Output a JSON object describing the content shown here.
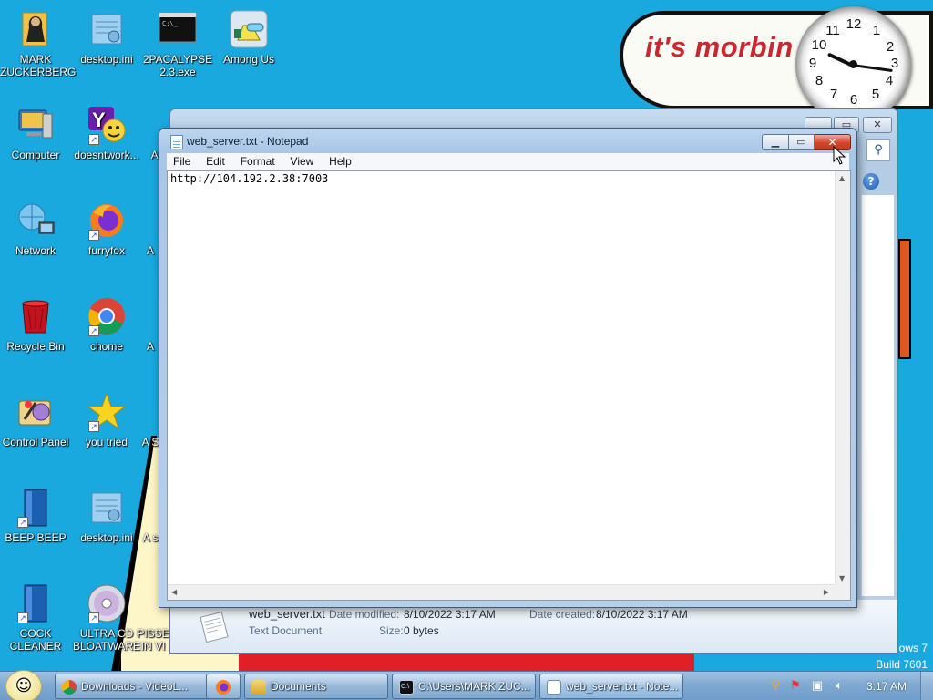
{
  "wallpaper": {
    "bubble_text": "it's morbin",
    "clock_numbers": [
      "12",
      "1",
      "2",
      "3",
      "4",
      "5",
      "6",
      "7",
      "8",
      "9",
      "10",
      "11"
    ],
    "windows_watermark": "lows 7",
    "build_text": "Build 7601"
  },
  "desktop_icons": [
    {
      "label": "MARK ZUCKERBERG",
      "icon": "user-folder-icon"
    },
    {
      "label": "desktop.ini",
      "icon": "settings-file-icon"
    },
    {
      "label": "2PACALYPSE 2.3.exe",
      "icon": "console-app-icon"
    },
    {
      "label": "Among Us",
      "icon": "among-us-icon"
    },
    {
      "label": "Computer",
      "icon": "computer-icon"
    },
    {
      "label": "doesntwork...",
      "icon": "yahoo-icon"
    },
    {
      "label": "Al",
      "icon": "partial-app-icon"
    },
    {
      "label": "Network",
      "icon": "network-icon"
    },
    {
      "label": "furryfox",
      "icon": "firefox-icon"
    },
    {
      "label": "A",
      "icon": "partial-app-icon"
    },
    {
      "label": "Recycle Bin",
      "icon": "recycle-bin-icon"
    },
    {
      "label": "chome",
      "icon": "chrome-icon"
    },
    {
      "label": "A",
      "icon": "partial-app-icon"
    },
    {
      "label": "Control Panel",
      "icon": "control-panel-icon"
    },
    {
      "label": "you tried",
      "icon": "star-icon"
    },
    {
      "label": "A S",
      "icon": "partial-app-icon"
    },
    {
      "label": "BEEP BEEP",
      "icon": "book-icon"
    },
    {
      "label": "desktop.ini",
      "icon": "settings-file-icon"
    },
    {
      "label": "A s",
      "icon": "partial-app-icon"
    },
    {
      "label": "COCK CLEANER",
      "icon": "book-icon"
    },
    {
      "label": "ULTRA CD BLOATWARE",
      "icon": "cd-icon"
    },
    {
      "label": "PISSE IN VI",
      "icon": "partial-app-icon"
    }
  ],
  "explorer": {
    "details": {
      "filename": "web_server.txt",
      "type": "Text Document",
      "modified_label": "Date modified:",
      "modified_value": "8/10/2022 3:17 AM",
      "created_label": "Date created:",
      "created_value": "8/10/2022 3:17 AM",
      "size_label": "Size:",
      "size_value": "0 bytes"
    }
  },
  "notepad": {
    "title": "web_server.txt - Notepad",
    "menu": [
      "File",
      "Edit",
      "Format",
      "View",
      "Help"
    ],
    "content": "http://104.192.2.38:7003"
  },
  "taskbar": {
    "tasks": [
      {
        "label": "Downloads - VideoL...",
        "icon": "chrome-icon"
      },
      {
        "label": "",
        "icon": "firefox-icon"
      },
      {
        "label": "Documents",
        "icon": "folder-icon"
      },
      {
        "label": "C:\\Users\\MARK ZUC...",
        "icon": "cmd-icon"
      },
      {
        "label": "web_server.txt - Note...",
        "icon": "notepad-icon"
      }
    ],
    "clock": "3:17 AM"
  },
  "colors": {
    "desktop": "#1aa9df",
    "close_button": "#d2452b",
    "bubble_text": "#c9282f"
  }
}
